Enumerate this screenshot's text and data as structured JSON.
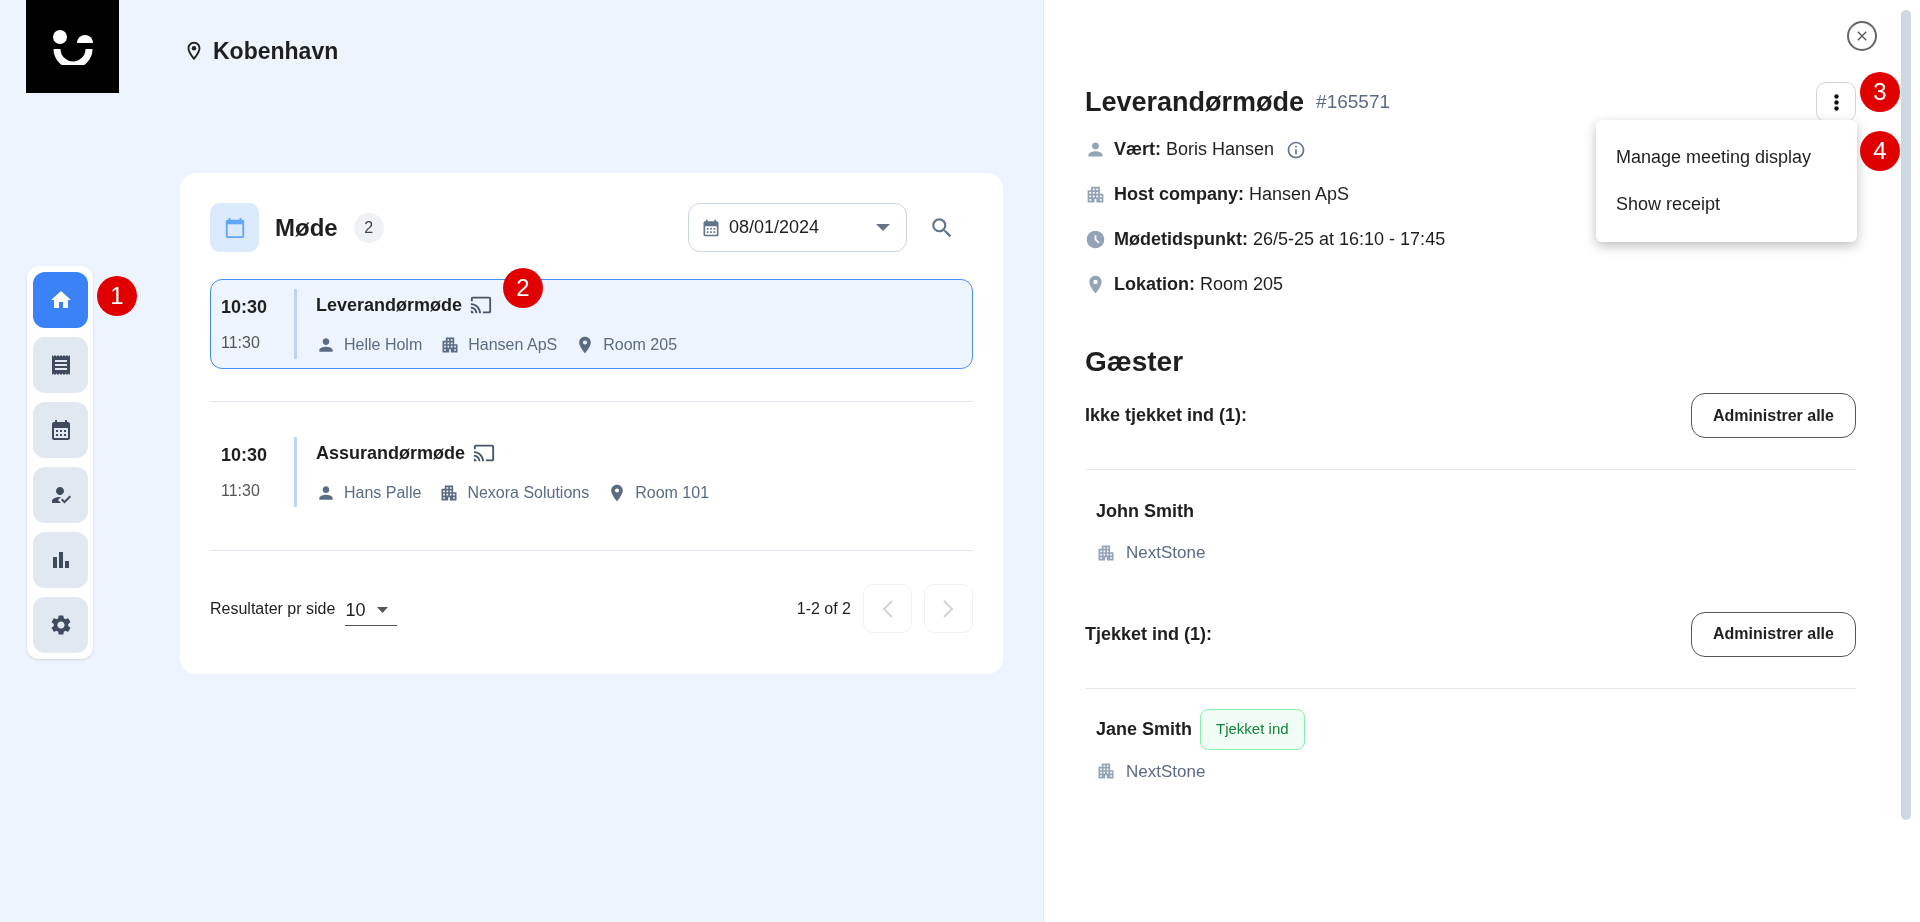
{
  "header": {
    "location": "Kobenhavn"
  },
  "sidebar": {
    "items": [
      {
        "selected": true
      },
      {
        "selected": false
      },
      {
        "selected": false
      },
      {
        "selected": false
      },
      {
        "selected": false
      },
      {
        "selected": false
      }
    ]
  },
  "meetings_card": {
    "title": "Møde",
    "count": "2",
    "date": "08/01/2024",
    "meetings": [
      {
        "start": "10:30",
        "end": "11:30",
        "title": "Leverandørmøde",
        "host": "Helle Holm",
        "company": "Hansen ApS",
        "room": "Room 205",
        "selected": true
      },
      {
        "start": "10:30",
        "end": "11:30",
        "title": "Assurandørmøde",
        "host": "Hans Palle",
        "company": "Nexora Solutions",
        "room": "Room 101",
        "selected": false
      }
    ],
    "footer": {
      "per_page_label": "Resultater pr side",
      "per_page": "10",
      "range": "1-2 of 2"
    }
  },
  "detail": {
    "title": "Leverandørmøde",
    "id": "#165571",
    "fields": [
      {
        "label": "Vært:",
        "value": "Boris Hansen",
        "has_info": true
      },
      {
        "label": "Host company:",
        "value": "Hansen ApS",
        "has_info": false
      },
      {
        "label": "Mødetidspunkt:",
        "value": "26/5-25 at 16:10 - 17:45",
        "has_info": false
      },
      {
        "label": "Lokation:",
        "value": "Room 205",
        "has_info": false
      }
    ],
    "menu": [
      "Manage meeting display",
      "Show receipt"
    ],
    "guests_title": "Gæster",
    "groups": [
      {
        "title": "Ikke tjekket ind (1):",
        "button": "Administrer alle",
        "guests": [
          {
            "name": "John Smith",
            "company": "NextStone"
          }
        ]
      },
      {
        "title": "Tjekket ind (1):",
        "button": "Administrer alle",
        "guests": [
          {
            "name": "Jane Smith",
            "company": "NextStone",
            "badge": "Tjekket ind"
          }
        ]
      }
    ]
  },
  "callouts": [
    "1",
    "2",
    "3",
    "4"
  ]
}
